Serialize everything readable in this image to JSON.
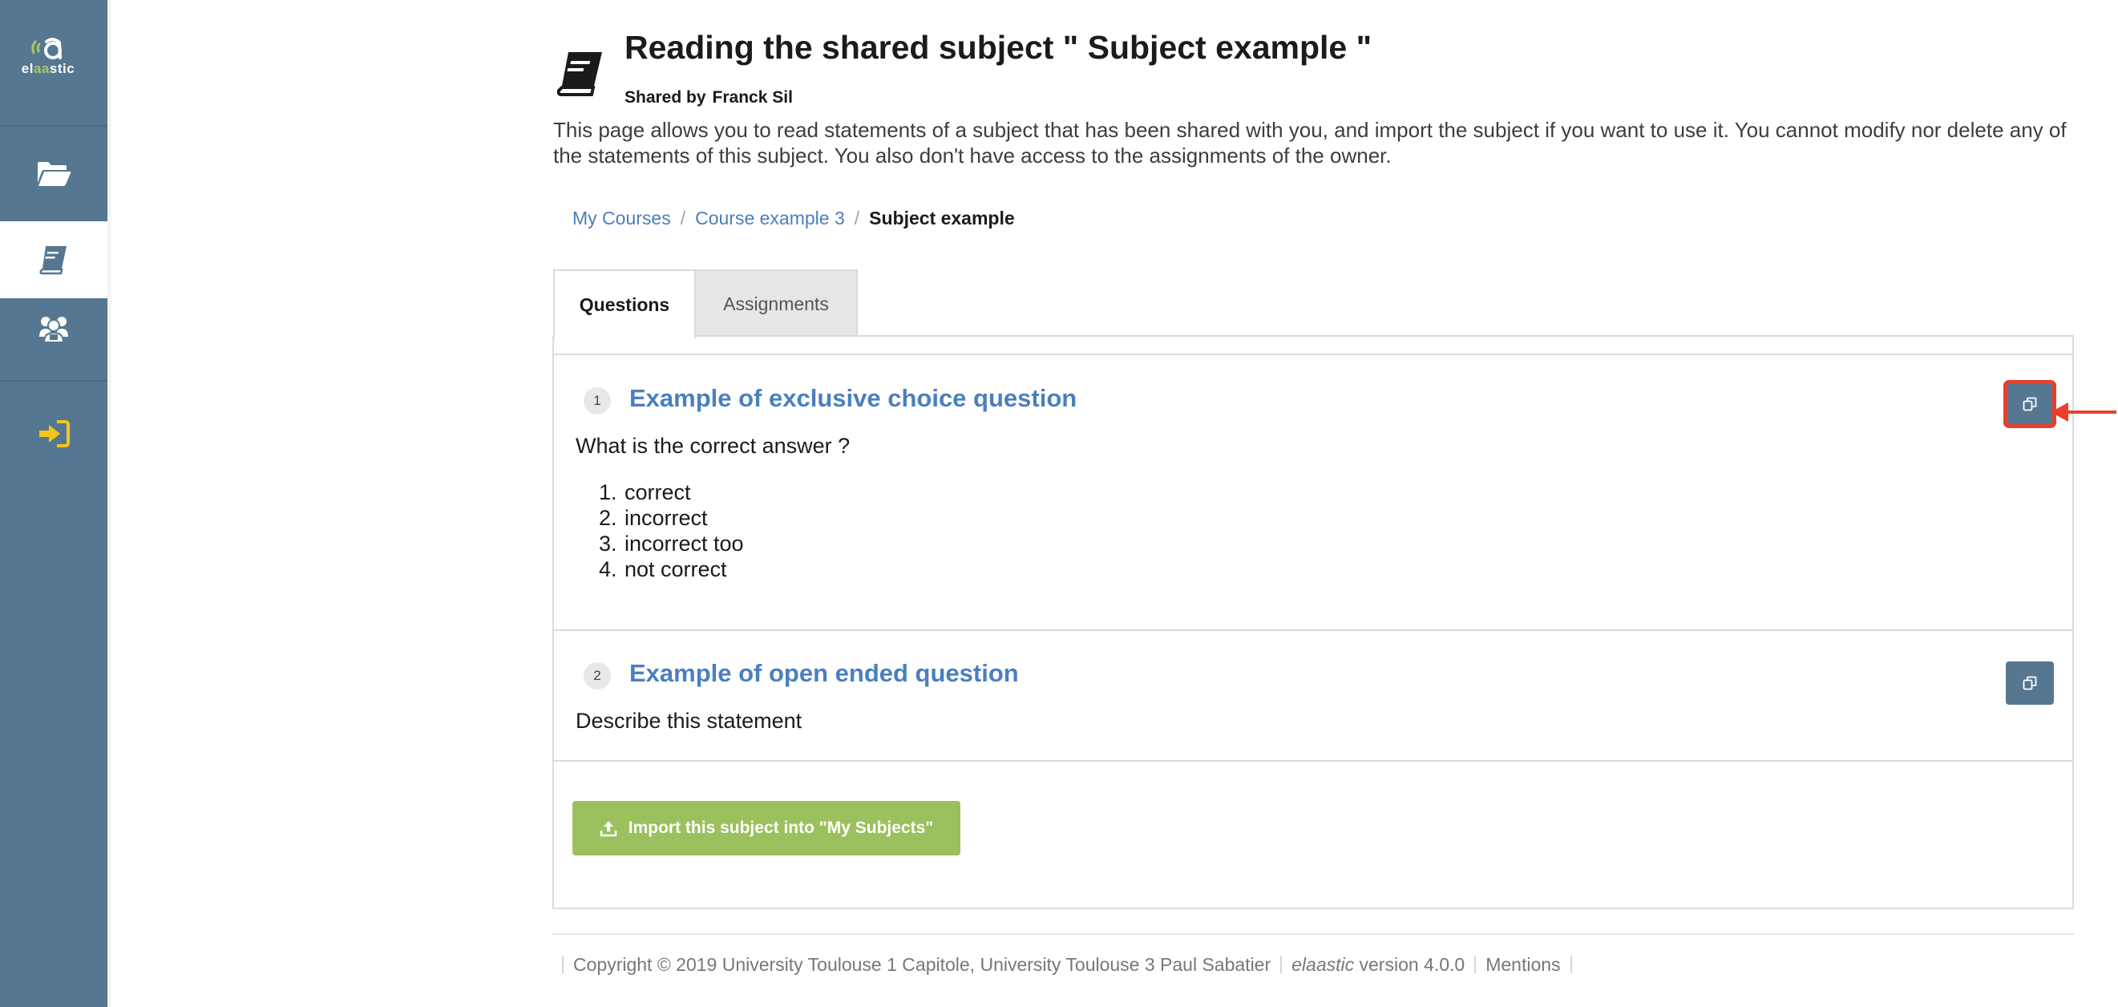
{
  "app": {
    "logo_text_pre": "el",
    "logo_text_accent": "aa",
    "logo_text_post": "stic"
  },
  "sidebar": {
    "items": [
      {
        "icon": "folder-open-icon",
        "active": false
      },
      {
        "icon": "book-icon",
        "active": true
      },
      {
        "icon": "users-icon",
        "active": false
      },
      {
        "icon": "sign-in-icon",
        "active": false
      }
    ]
  },
  "header": {
    "title": "Reading the shared subject \" Subject example \"",
    "shared_by_label": "Shared by",
    "shared_by_name": "Franck Sil",
    "description": "This page allows you to read statements of a subject that has been shared with you, and import the subject if you want to use it. You cannot modify nor delete any of the statements of this subject. You also don't have access to the assignments of the owner."
  },
  "breadcrumb": {
    "items": [
      "My Courses",
      "Course example 3"
    ],
    "current": "Subject example",
    "separator": "/"
  },
  "tabs": [
    {
      "label": "Questions",
      "active": true
    },
    {
      "label": "Assignments",
      "active": false
    }
  ],
  "questions": [
    {
      "number": "1",
      "title": "Example of exclusive choice question",
      "statement": "What is the correct answer ?",
      "choices": [
        "correct",
        "incorrect",
        "incorrect too",
        "not correct"
      ]
    },
    {
      "number": "2",
      "title": "Example of open ended question",
      "statement": "Describe this statement"
    }
  ],
  "import_button": {
    "label": "Import this subject into \"My Subjects\""
  },
  "footer": {
    "copyright": "Copyright © 2019 University Toulouse 1 Capitole, University Toulouse 3 Paul Sabatier",
    "brand": "elaastic",
    "version": "version 4.0.0",
    "mentions": "Mentions"
  },
  "colors": {
    "sidebar": "#557791",
    "link": "#4a7fbf",
    "import_button": "#9bc05e",
    "highlight": "#e8402a",
    "sign_in_icon": "#f5c518"
  }
}
